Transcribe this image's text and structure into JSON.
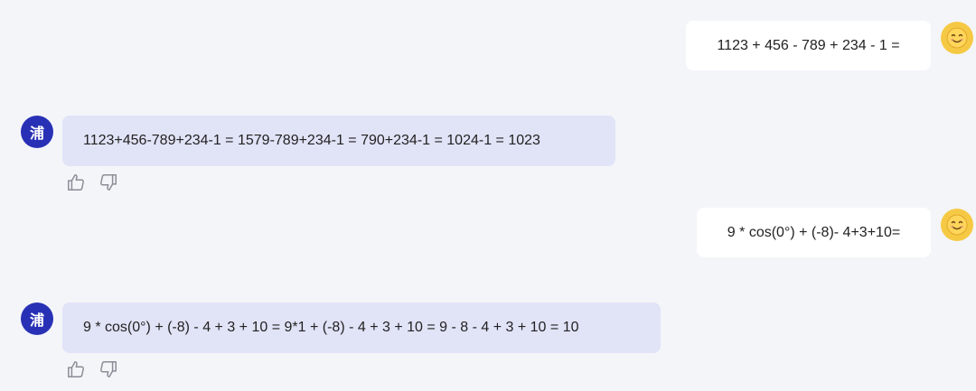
{
  "conversation": {
    "messages": [
      {
        "role": "user",
        "avatar_icon": "smiley-face-icon",
        "text": "1123 + 456 - 789 + 234 - 1 ="
      },
      {
        "role": "assistant",
        "avatar_label": "浦",
        "text": "1123+456-789+234-1 = 1579-789+234-1 = 790+234-1 = 1024-1 = 1023",
        "actions": [
          "thumbs-up-icon",
          "thumbs-down-icon"
        ]
      },
      {
        "role": "user",
        "avatar_icon": "smiley-face-icon",
        "text": "9 * cos(0°) + (-8)- 4+3+10="
      },
      {
        "role": "assistant",
        "avatar_label": "浦",
        "text": "9 * cos(0°) + (-8) - 4 + 3 + 10 = 9*1 + (-8) - 4 + 3 + 10 = 9 - 8 - 4 + 3 + 10 = 10",
        "actions": [
          "thumbs-up-icon",
          "thumbs-down-icon"
        ]
      }
    ]
  },
  "colors": {
    "page_background": "#f4f5f9",
    "user_bubble": "#ffffff",
    "assistant_bubble": "#e1e3f7",
    "assistant_avatar": "#2831b5",
    "user_avatar": "#f6c945"
  }
}
